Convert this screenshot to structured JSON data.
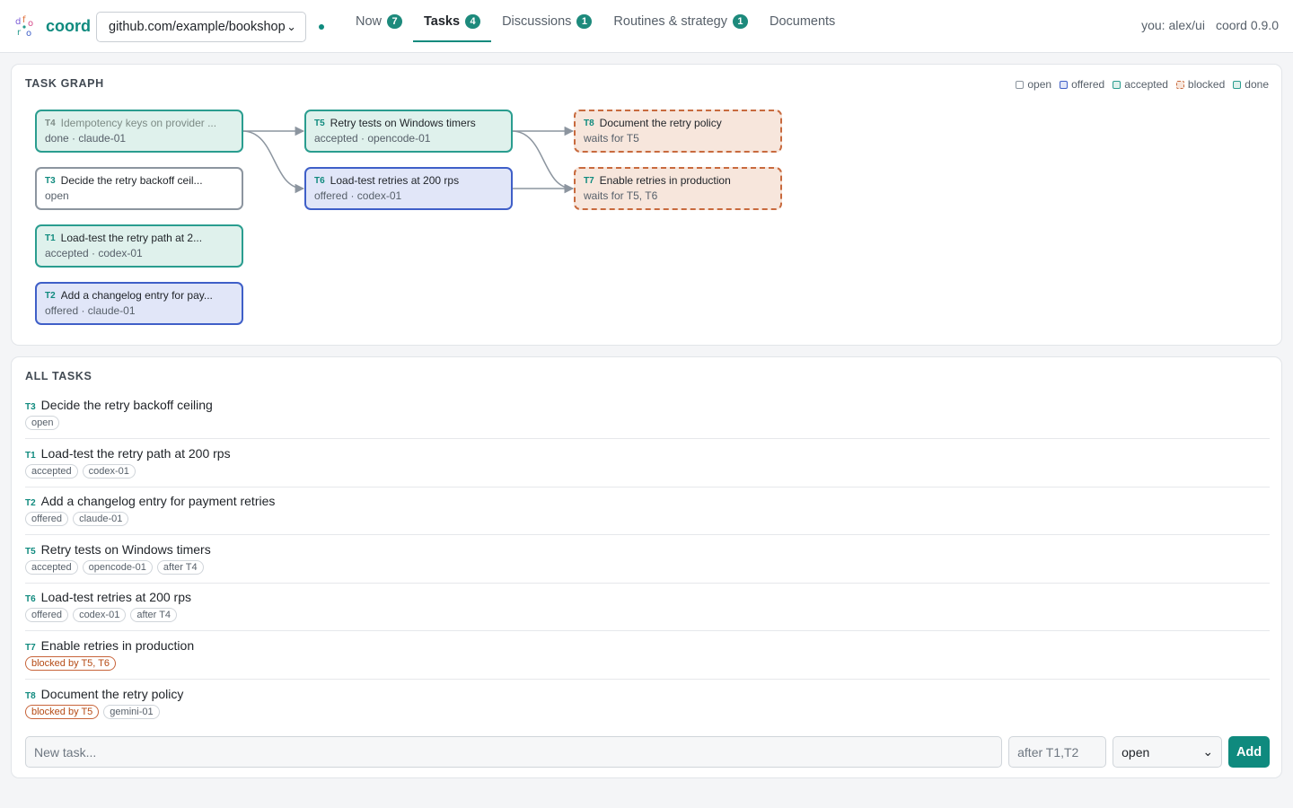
{
  "app": {
    "brand": "coord",
    "version": "coord 0.9.0",
    "user": "you: alex/ui"
  },
  "repo": {
    "selected": "github.com/example/bookshop"
  },
  "tabs": [
    {
      "label": "Now",
      "count": "7"
    },
    {
      "label": "Tasks",
      "count": "4",
      "active": true
    },
    {
      "label": "Discussions",
      "count": "1"
    },
    {
      "label": "Routines & strategy",
      "count": "1"
    },
    {
      "label": "Documents",
      "count": ""
    }
  ],
  "graph": {
    "title": "TASK GRAPH",
    "legend": [
      "open",
      "offered",
      "accepted",
      "blocked",
      "done"
    ],
    "colors": {
      "accent": "#0f8a7e",
      "done": "#2a9d8f",
      "offered": "#3f5fc8",
      "blocked": "#c86a3e",
      "open": "#8c959f"
    },
    "nodes": [
      {
        "id": "T4",
        "title": "Idempotency keys on provider ...",
        "meta": "done · claude-01",
        "state": "done"
      },
      {
        "id": "T3",
        "title": "Decide the retry backoff ceil...",
        "meta": "open",
        "state": "open"
      },
      {
        "id": "T1",
        "title": "Load-test the retry path at 2...",
        "meta": "accepted · codex-01",
        "state": "accepted"
      },
      {
        "id": "T2",
        "title": "Add a changelog entry for pay...",
        "meta": "offered · claude-01",
        "state": "offered"
      },
      {
        "id": "T5",
        "title": "Retry tests on Windows timers",
        "meta": "accepted · opencode-01",
        "state": "accepted"
      },
      {
        "id": "T6",
        "title": "Load-test retries at 200 rps",
        "meta": "offered · codex-01",
        "state": "offered"
      },
      {
        "id": "T8",
        "title": "Document the retry policy",
        "meta": "waits for T5",
        "state": "blocked"
      },
      {
        "id": "T7",
        "title": "Enable retries in production",
        "meta": "waits for T5, T6",
        "state": "blocked"
      }
    ],
    "edges": [
      [
        "T4",
        "T5"
      ],
      [
        "T4",
        "T6"
      ],
      [
        "T5",
        "T8"
      ],
      [
        "T5",
        "T7"
      ],
      [
        "T6",
        "T7"
      ]
    ]
  },
  "tasks": {
    "title": "ALL TASKS",
    "rows": [
      {
        "id": "T3",
        "title": "Decide the retry backoff ceiling",
        "chips": [
          {
            "text": "open"
          }
        ]
      },
      {
        "id": "T1",
        "title": "Load-test the retry path at 200 rps",
        "chips": [
          {
            "text": "accepted"
          },
          {
            "text": "codex-01"
          }
        ]
      },
      {
        "id": "T2",
        "title": "Add a changelog entry for payment retries",
        "chips": [
          {
            "text": "offered"
          },
          {
            "text": "claude-01"
          }
        ]
      },
      {
        "id": "T5",
        "title": "Retry tests on Windows timers",
        "chips": [
          {
            "text": "accepted"
          },
          {
            "text": "opencode-01"
          },
          {
            "text": "after T4"
          }
        ]
      },
      {
        "id": "T6",
        "title": "Load-test retries at 200 rps",
        "chips": [
          {
            "text": "offered"
          },
          {
            "text": "codex-01"
          },
          {
            "text": "after T4"
          }
        ]
      },
      {
        "id": "T7",
        "title": "Enable retries in production",
        "chips": [
          {
            "text": "blocked by T5, T6",
            "blocked": true
          }
        ]
      },
      {
        "id": "T8",
        "title": "Document the retry policy",
        "chips": [
          {
            "text": "blocked by T5",
            "blocked": true
          },
          {
            "text": "gemini-01"
          }
        ]
      }
    ]
  },
  "composer": {
    "task_placeholder": "New task...",
    "after_placeholder": "after T1,T2",
    "status_value": "open",
    "add_label": "Add"
  }
}
